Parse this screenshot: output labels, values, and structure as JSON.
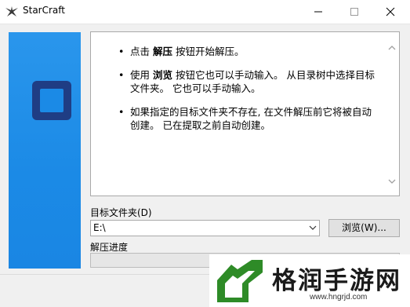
{
  "window": {
    "title": "StarCraft",
    "icon": "starcraft-logo-icon"
  },
  "info": {
    "items": [
      {
        "pre": "点击 ",
        "bold": "解压",
        "post": " 按钮开始解压。"
      },
      {
        "pre": "使用 ",
        "bold": "浏览",
        "post": " 按钮它也可以手动输入。 从目录树中选择目标文件夹。 它也可以手动输入。"
      },
      {
        "pre": "",
        "bold": "",
        "post": "如果指定的目标文件夹不存在, 在文件解压前它将被自动创建。 已在提取之前自动创建。"
      }
    ]
  },
  "target": {
    "label": "目标文件夹(D)",
    "value": "E:\\"
  },
  "browse_label": "浏览(W)...",
  "progress": {
    "label": "解压进度",
    "value": 0
  },
  "watermark": {
    "brand": "格润手游网",
    "url": "www.hngrjd.com"
  },
  "colors": {
    "sidebar": "#1a86e3",
    "logo": "#1f3d84",
    "watermark_green": "#2e8b27"
  }
}
